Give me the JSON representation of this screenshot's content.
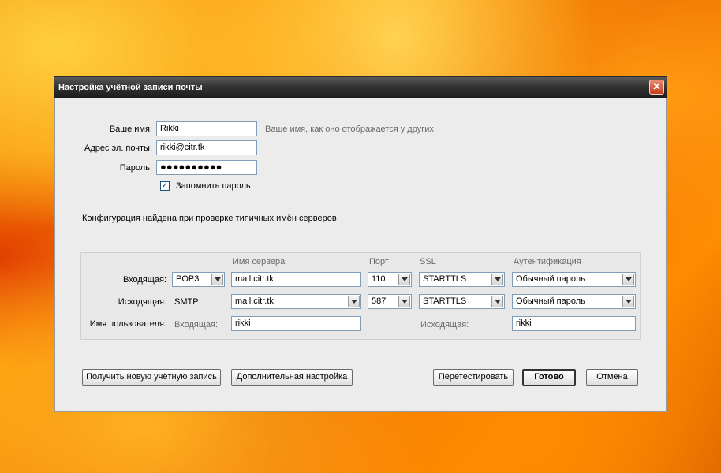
{
  "window": {
    "title": "Настройка учётной записи почты",
    "close_symbol": "✕"
  },
  "account": {
    "name_label": "Ваше имя:",
    "name_value": "Rikki",
    "name_hint": "Ваше имя, как оно отображается у других",
    "email_label": "Адрес эл. почты:",
    "email_value": "rikki@citr.tk",
    "password_label": "Пароль:",
    "password_value": "●●●●●●●●●●",
    "remember_label": "Запомнить пароль",
    "remember_checked": true,
    "check_symbol": "✓"
  },
  "status_message": "Конфигурация найдена при проверке типичных имён серверов",
  "server_config": {
    "headers": {
      "server_name": "Имя сервера",
      "port": "Порт",
      "ssl": "SSL",
      "auth": "Аутентификация"
    },
    "incoming": {
      "label": "Входящая:",
      "protocol": "POP3",
      "server": "mail.citr.tk",
      "port": "110",
      "ssl": "STARTTLS",
      "auth": "Обычный пароль"
    },
    "outgoing": {
      "label": "Исходящая:",
      "protocol": "SMTP",
      "server": "mail.citr.tk",
      "port": "587",
      "ssl": "STARTTLS",
      "auth": "Обычный пароль"
    },
    "username": {
      "label": "Имя пользователя:",
      "incoming_label": "Входящая:",
      "incoming_value": "rikki",
      "outgoing_label": "Исходящая:",
      "outgoing_value": "rikki"
    }
  },
  "buttons": {
    "new_account": "Получить новую учётную запись",
    "advanced": "Дополнительная настройка",
    "retest": "Перетестировать",
    "done": "Готово",
    "cancel": "Отмена"
  }
}
